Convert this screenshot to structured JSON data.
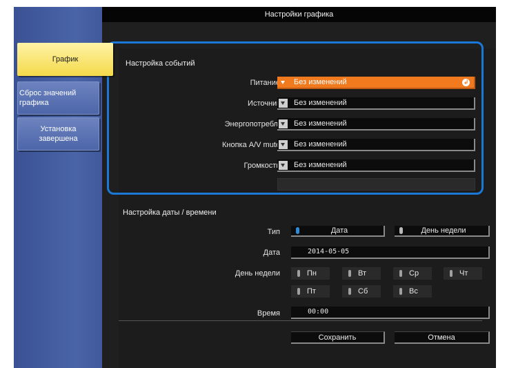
{
  "window": {
    "title": "Настройки графика"
  },
  "sidebar": {
    "items": [
      {
        "label": "График",
        "active": true
      },
      {
        "label": "Сброс значений графика",
        "active": false
      },
      {
        "label": "Установка завершена",
        "active": false
      }
    ]
  },
  "events": {
    "section_label": "Настройка событий",
    "rows": [
      {
        "label": "Питание",
        "value": "Без изменений"
      },
      {
        "label": "Источник",
        "value": "Без изменений"
      },
      {
        "label": "Энергопотребл.",
        "value": "Без изменений"
      },
      {
        "label": "Кнопка A/V mute",
        "value": "Без изменений"
      },
      {
        "label": "Громкость",
        "value": "Без изменений"
      }
    ]
  },
  "datetime": {
    "section_label": "Настройка даты / времени",
    "type_label": "Тип",
    "type_options": [
      "Дата",
      "День недели"
    ],
    "date_label": "Дата",
    "date_value": "2014-05-05",
    "weekday_label": "День недели",
    "weekdays": [
      "Пн",
      "Вт",
      "Ср",
      "Чт",
      "Пт",
      "Сб",
      "Вс"
    ],
    "time_label": "Время",
    "time_value": "00:00"
  },
  "actions": {
    "save": "Сохранить",
    "cancel": "Отмена"
  },
  "colors": {
    "highlight": "#1a78d6",
    "active_dropdown": "#f07a1d",
    "sidebar": "#4a64a8",
    "active_tab": "#f4d94a"
  }
}
